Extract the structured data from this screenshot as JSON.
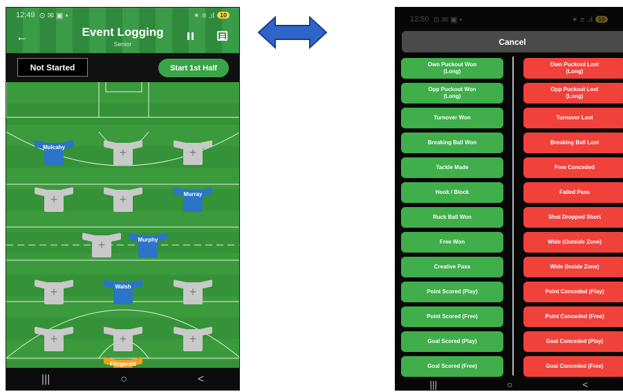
{
  "left_phone": {
    "status_time": "12:49",
    "status_icons": "⊙ ✉ ▣ •",
    "status_right": "✶ ≡ .ıl",
    "battery": "10",
    "title": "Event Logging",
    "subtitle": "Senior",
    "match_status": "Not Started",
    "start_button": "Start 1st Half",
    "players": [
      {
        "name": "Mulcahy",
        "color": "blue"
      },
      {
        "name": "",
        "color": "grey"
      },
      {
        "name": "",
        "color": "grey"
      },
      {
        "name": "",
        "color": "grey"
      },
      {
        "name": "",
        "color": "grey"
      },
      {
        "name": "Murray",
        "color": "blue"
      },
      {
        "name": "",
        "color": "grey"
      },
      {
        "name": "Murphy",
        "color": "blue"
      },
      {
        "name": "",
        "color": "grey"
      },
      {
        "name": "Walsh",
        "color": "blue"
      },
      {
        "name": "",
        "color": "grey"
      },
      {
        "name": "",
        "color": "grey"
      },
      {
        "name": "",
        "color": "grey"
      },
      {
        "name": "",
        "color": "grey"
      },
      {
        "name": "Fitzgerald",
        "color": "orange"
      }
    ],
    "plus_symbol": "+",
    "nav": {
      "recent": "|||",
      "home": "○",
      "back": "<"
    }
  },
  "right_phone": {
    "status_time": "12:50",
    "status_icons": "⊙ ✉ ▣ •",
    "status_right": "✶ ≡ .ıl",
    "battery": "10",
    "cancel_label": "Cancel",
    "won_events": [
      "Own Puckout Won\n(Long)",
      "Opp Puckout Won\n(Long)",
      "Turnover Won",
      "Breaking Ball Won",
      "Tackle Made",
      "Hook / Block",
      "Ruck Ball Won",
      "Free Won",
      "Creative Pass",
      "Point Scored (Play)",
      "Point Scored (Free)",
      "Goal Scored (Play)",
      "Goal Scored (Free)"
    ],
    "lost_events": [
      "Own Puckout Lost\n(Long)",
      "Opp Puckout Lost\n(Long)",
      "Turnover Lost",
      "Breaking Ball Lost",
      "Free Conceded",
      "Failed Pass",
      "Shot Dropped Short",
      "Wide (Outside Zone)",
      "Wide (Inside Zone)",
      "Point Conceded (Play)",
      "Point Conceded (Free)",
      "Goal Conceded (Play)",
      "Goal Conceded (Free)"
    ],
    "nav": {
      "recent": "|||",
      "home": "○",
      "back": "<"
    }
  },
  "colors": {
    "won": "#3fae4b",
    "lost": "#f0413b",
    "arrow": "#2f64c8",
    "pitch": "#3a9a3c"
  },
  "icons": [
    "back-arrow-icon",
    "pause-icon",
    "event-log-icon",
    "double-arrow-icon",
    "recent-apps-icon",
    "home-icon",
    "back-icon"
  ]
}
